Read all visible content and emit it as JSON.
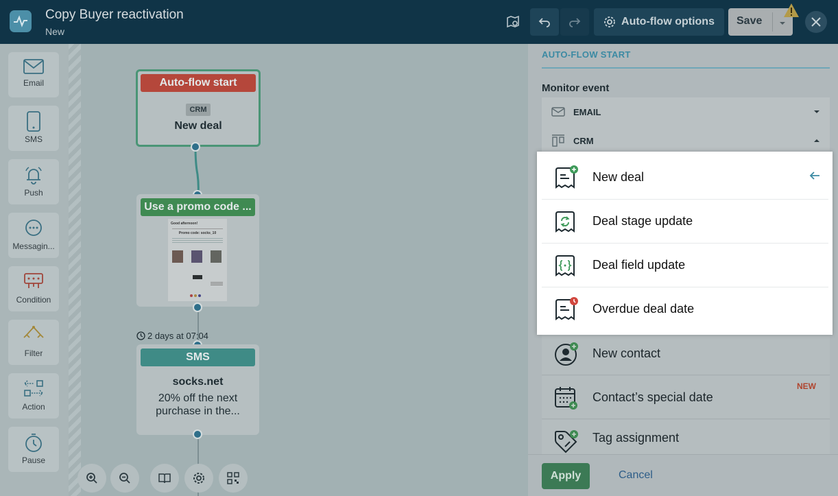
{
  "header": {
    "title": "Copy Buyer reactivation",
    "subtitle": "New",
    "auto_flow_options": "Auto-flow options",
    "save": "Save"
  },
  "palette": {
    "items": [
      {
        "label": "Email",
        "icon": "envelope-icon"
      },
      {
        "label": "SMS",
        "icon": "phone-icon"
      },
      {
        "label": "Push",
        "icon": "bell-icon"
      },
      {
        "label": "Messagin...",
        "icon": "chat-bubble-icon"
      },
      {
        "label": "Condition",
        "icon": "condition-icon"
      },
      {
        "label": "Filter",
        "icon": "filter-icon"
      },
      {
        "label": "Action",
        "icon": "action-icon"
      },
      {
        "label": "Pause",
        "icon": "stopwatch-icon"
      }
    ]
  },
  "canvas": {
    "start_node": {
      "header": "Auto-flow start",
      "badge": "CRM",
      "text": "New deal"
    },
    "email_node": {
      "header": "Use a promo code ...",
      "preview": {
        "greeting": "Good afternoon!",
        "code_line": "Promo code: socks_10"
      }
    },
    "delay_label": "2 days at 07:04",
    "sms_node": {
      "header": "SMS",
      "sender": "socks.net",
      "text_line1": "20% off the next",
      "text_line2": "purchase in the..."
    }
  },
  "panel": {
    "section_title": "AUTO-FLOW START",
    "monitor_event_label": "Monitor event",
    "groups": [
      {
        "label": "EMAIL",
        "icon": "envelope-icon",
        "expanded": false
      },
      {
        "label": "CRM",
        "icon": "crm-icon",
        "expanded": true
      }
    ],
    "crm_events": [
      {
        "label": "New deal",
        "icon": "deal-add-icon",
        "selected": true
      },
      {
        "label": "Deal stage update",
        "icon": "deal-refresh-icon"
      },
      {
        "label": "Deal field update",
        "icon": "deal-field-icon"
      },
      {
        "label": "Overdue deal date",
        "icon": "deal-clock-icon"
      }
    ],
    "contact_events": [
      {
        "label": "New contact",
        "icon": "contact-add-icon"
      },
      {
        "label": "Contact’s special date",
        "icon": "calendar-add-icon",
        "badge": "NEW"
      },
      {
        "label": "Tag assignment",
        "icon": "tag-add-icon"
      }
    ],
    "apply": "Apply",
    "cancel": "Cancel"
  },
  "colors": {
    "header_bg": "#103447",
    "accent_teal": "#3b8aa3",
    "start_red": "#b5473b",
    "email_green": "#3f8a52",
    "sms_teal": "#3f8b86",
    "apply_green": "#3c7a55",
    "new_badge": "#b0452e"
  }
}
